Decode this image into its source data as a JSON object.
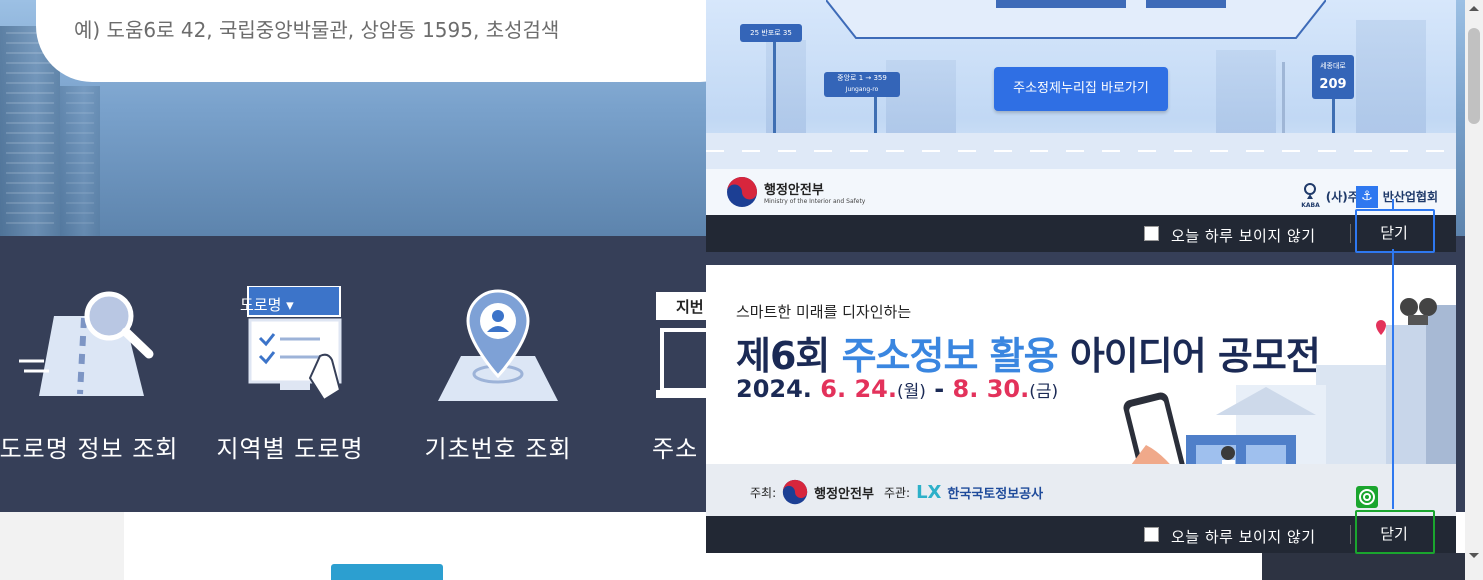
{
  "search": {
    "placeholder": "예) 도움6로 42, 국립중앙박물관, 상암동 1595, 초성검색"
  },
  "nav": {
    "items": [
      {
        "label": "도로명 정보 조회",
        "icon": "map-magnifier-icon"
      },
      {
        "label": "지역별 도로명",
        "icon": "monitor-touch-icon",
        "tag": "도로명"
      },
      {
        "label": "기초번호 조회",
        "icon": "location-pin-icon"
      },
      {
        "label": "주소",
        "icon": "laptop-icon",
        "tag": "지번"
      }
    ]
  },
  "popup1": {
    "shortcut_label": "주소정제누리집 바로가기",
    "signs": {
      "a_top": "반포로",
      "a_left": "25",
      "a_right": "35",
      "b_top": "중앙로",
      "b_sub": "Jungang-ro",
      "b_range": "1 → 359",
      "c_top": "세종대로",
      "c_num": "209"
    },
    "ministry_name": "행정안전부",
    "ministry_en": "Ministry of the Interior and Safety",
    "kaba_label": "(사)주",
    "kaba_rest": "반산업협회",
    "kaba_small": "KABA",
    "skip_label": "오늘 하루 보이지 않기",
    "close_label": "닫기"
  },
  "popup2": {
    "subtitle": "스마트한 미래를 디자인하는",
    "title_a": "제6회 ",
    "title_b": "주소정보 활용",
    "title_c": " 아이디어 공모전",
    "date_year": "2024. ",
    "date_start": "6. 24.",
    "date_start_day": "(월)",
    "date_dash": " - ",
    "date_end": "8. 30.",
    "date_end_day": "(금)",
    "host_label": "주최:",
    "host_name": "행정안전부",
    "organizer_label": "주관:",
    "organizer_name": "한국국토정보공사",
    "organizer_mark": "LX",
    "skip_label": "오늘 하루 보이지 않기",
    "close_label": "닫기"
  },
  "colors": {
    "nav_band": "#363f58",
    "popup_footer": "#222834",
    "accent_blue": "#2f6fe4",
    "title_blue": "#3a86e0",
    "date_red": "#e3325b",
    "overlay_blue": "#2e78f0",
    "overlay_green": "#1aa52e"
  }
}
